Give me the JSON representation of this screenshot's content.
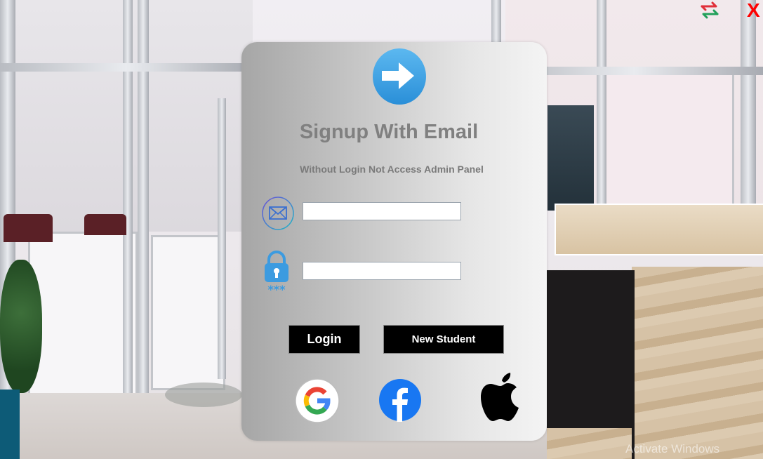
{
  "window": {
    "swap_icon": "swap-arrows-icon",
    "close_label": "X"
  },
  "card": {
    "logo_icon": "arrow-right-circle-icon",
    "title": "Signup With Email",
    "subtitle": "Without Login Not Access Admin Panel",
    "email": {
      "icon": "mail-icon",
      "value": "",
      "placeholder": ""
    },
    "password": {
      "icon": "lock-icon",
      "value": "",
      "placeholder": ""
    },
    "login_label": "Login",
    "new_student_label": "New Student",
    "social": [
      "google-icon",
      "facebook-icon",
      "apple-icon"
    ]
  },
  "os_watermark": "Activate Windows",
  "colors": {
    "accent_blue": "#2f9be0",
    "close_red": "#ff0000",
    "button_bg": "#000000",
    "title_gray": "#808080"
  }
}
